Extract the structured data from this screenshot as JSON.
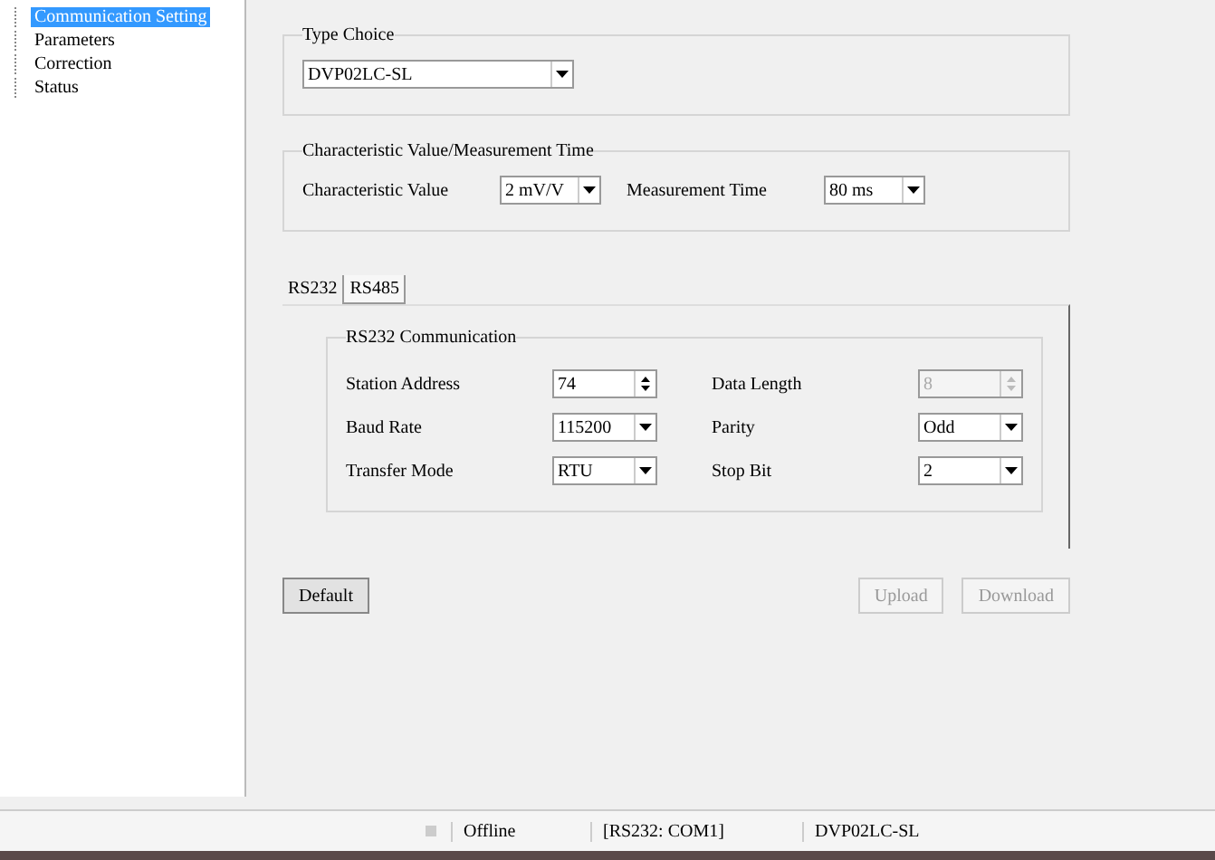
{
  "tree": [
    {
      "label": "Communication Setting",
      "selected": true
    },
    {
      "label": "Parameters",
      "selected": false
    },
    {
      "label": "Correction",
      "selected": false
    },
    {
      "label": "Status",
      "selected": false
    }
  ],
  "type_choice": {
    "title": "Type Choice",
    "value": "DVP02LC-SL"
  },
  "characteristic": {
    "title": "Characteristic Value/Measurement Time",
    "fields": [
      {
        "label": "Characteristic Value",
        "value": "2 mV/V"
      },
      {
        "label": "Measurement Time",
        "value": "80 ms"
      }
    ]
  },
  "tabs": [
    {
      "label": "RS232",
      "selected": true
    },
    {
      "label": "RS485",
      "selected": false
    }
  ],
  "rs232": {
    "title": "RS232 Communication",
    "fields": [
      {
        "label": "Station Address",
        "value": "74",
        "kind": "spin",
        "disabled": false
      },
      {
        "label": "Data Length",
        "value": "8",
        "kind": "spin",
        "disabled": true
      },
      {
        "label": "Baud Rate",
        "value": "115200",
        "kind": "select",
        "disabled": false
      },
      {
        "label": "Parity",
        "value": "Odd",
        "kind": "select",
        "disabled": false
      },
      {
        "label": "Transfer Mode",
        "value": "RTU",
        "kind": "select",
        "disabled": false
      },
      {
        "label": "Stop Bit",
        "value": "2",
        "kind": "select",
        "disabled": false
      }
    ]
  },
  "buttons": [
    {
      "label": "Default",
      "disabled": false
    },
    {
      "label": "Upload",
      "disabled": true
    },
    {
      "label": "Download",
      "disabled": true
    }
  ],
  "status_bar": [
    "Offline",
    "[RS232: COM1]",
    "DVP02LC-SL"
  ]
}
